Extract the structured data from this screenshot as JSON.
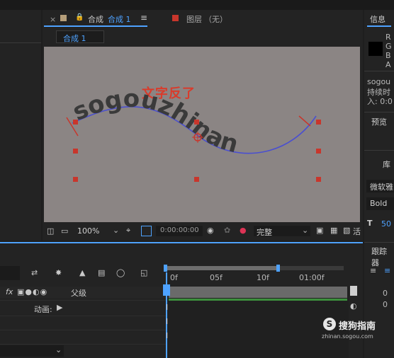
{
  "comp_panel": {
    "close_glyph": "×",
    "menu_glyph": "≡",
    "title_prefix": "合成",
    "title_name": "合成 1",
    "layer_prefix": "图层",
    "layer_value": "（无）",
    "tab_label": "合成 1"
  },
  "viewer": {
    "annotation": "文字反了",
    "curved_text": "sogouzhinan"
  },
  "viewer_toolbar": {
    "zoom": "100%",
    "timecode": "0:00:00:00",
    "quality": "完整",
    "last_label": "活"
  },
  "right_panel": {
    "info_tab": "信息",
    "channels": [
      "R",
      "G",
      "B",
      "A"
    ],
    "sogou_text": "sogou",
    "duration_text": "持续时",
    "in_text": "入: 0:0",
    "preview_tab": "预览",
    "library_tab": "库",
    "font_name": "微软雅",
    "font_style": "Bold",
    "font_size": "50",
    "tracker_tab": "跟踪器",
    "value_a": "0",
    "value_b": "0"
  },
  "timeline": {
    "ruler": [
      "0f",
      "05f",
      "10f",
      "01:00f"
    ],
    "fx_label": "fx",
    "parent_label": "父级",
    "anim_label": "动画:"
  },
  "watermark": {
    "brand": "搜狗指南",
    "url": "zhinan.sogou.com"
  },
  "colors": {
    "accent": "#4ea2ff",
    "viewer_bg": "#8b8584",
    "annotation": "#d93b2b",
    "path": "#4a4fd0"
  }
}
